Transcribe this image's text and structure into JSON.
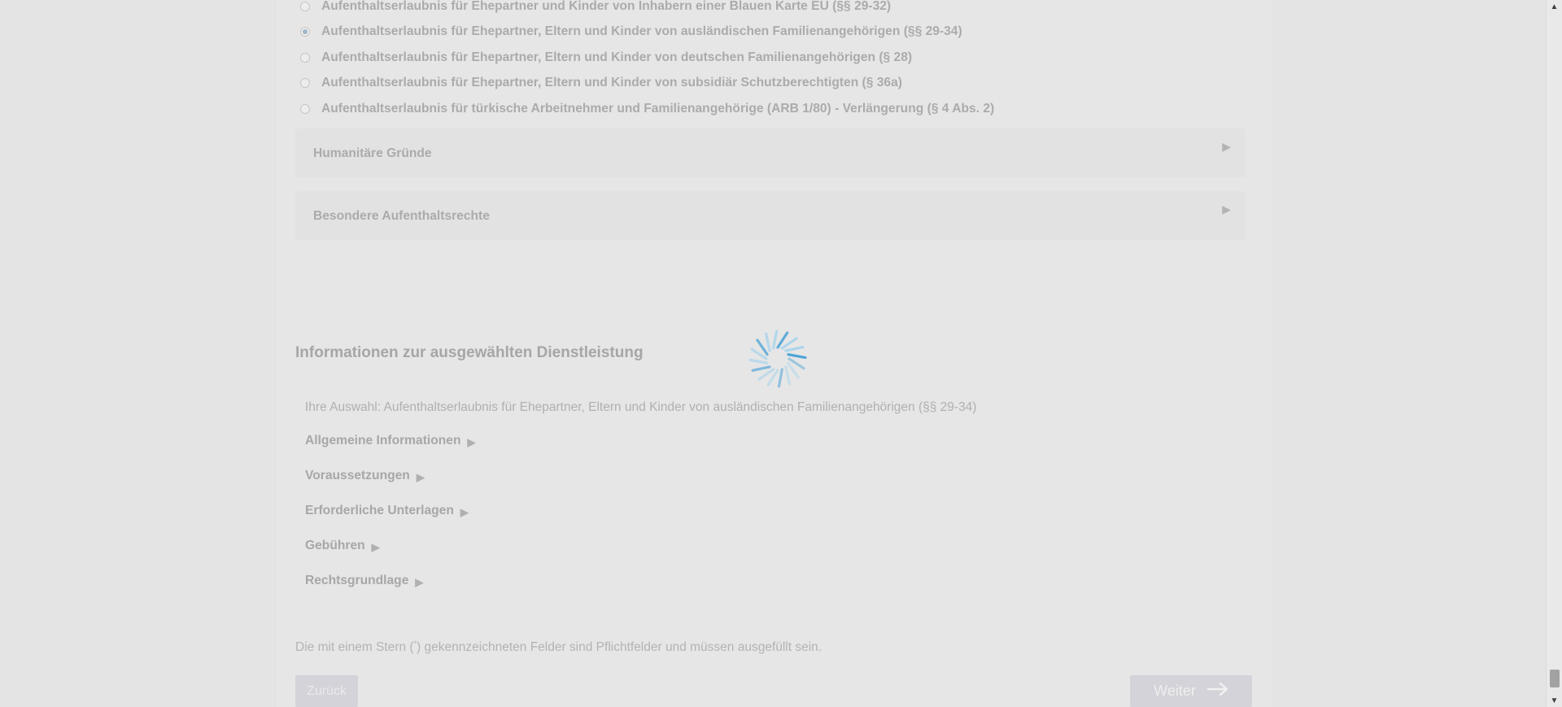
{
  "radio_options": [
    {
      "label": "Aufenthaltserlaubnis für Ehepartner und Kinder von Inhabern einer Blauen Karte EU (§§ 29-32)",
      "checked": false
    },
    {
      "label": "Aufenthaltserlaubnis für Ehepartner, Eltern und Kinder von ausländischen Familienangehörigen (§§ 29-34)",
      "checked": true
    },
    {
      "label": "Aufenthaltserlaubnis für Ehepartner, Eltern und Kinder von deutschen Familienangehörigen (§ 28)",
      "checked": false
    },
    {
      "label": "Aufenthaltserlaubnis für Ehepartner, Eltern und Kinder von subsidiär Schutzberechtigten (§ 36a)",
      "checked": false
    },
    {
      "label": "Aufenthaltserlaubnis für türkische Arbeitnehmer und Familienangehörige (ARB 1/80) - Verlängerung (§ 4 Abs. 2)",
      "checked": false
    }
  ],
  "accordions": {
    "humanitaere": "Humanitäre Gründe",
    "besondere": "Besondere Aufenthaltsrechte",
    "arrow": "▶"
  },
  "info": {
    "title": "Informationen zur ausgewählten Dienstleistung",
    "selection": "Ihre Auswahl: Aufenthaltserlaubnis für Ehepartner, Eltern und Kinder von ausländischen Familienangehörigen (§§ 29-34)",
    "links": [
      "Allgemeine Informationen",
      "Voraussetzungen",
      "Erforderliche Unterlagen",
      "Gebühren",
      "Rechtsgrundlage"
    ],
    "link_arrow": "▶"
  },
  "footnote": {
    "before": "Die mit einem Stern (",
    "star": "*",
    "after": ") gekennzeichneten Felder sind Pflichtfelder und müssen ausgefüllt sein."
  },
  "buttons": {
    "back": "Zurück",
    "next": "Weiter",
    "next_icon": "arrow-right-icon"
  },
  "scrollbar": {
    "up": "▲",
    "down": "▼"
  },
  "colors": {
    "overlay": "#e4e4e4",
    "spinner_blue": "#4aa3d6",
    "spinner_light": "#a9d4ec"
  }
}
